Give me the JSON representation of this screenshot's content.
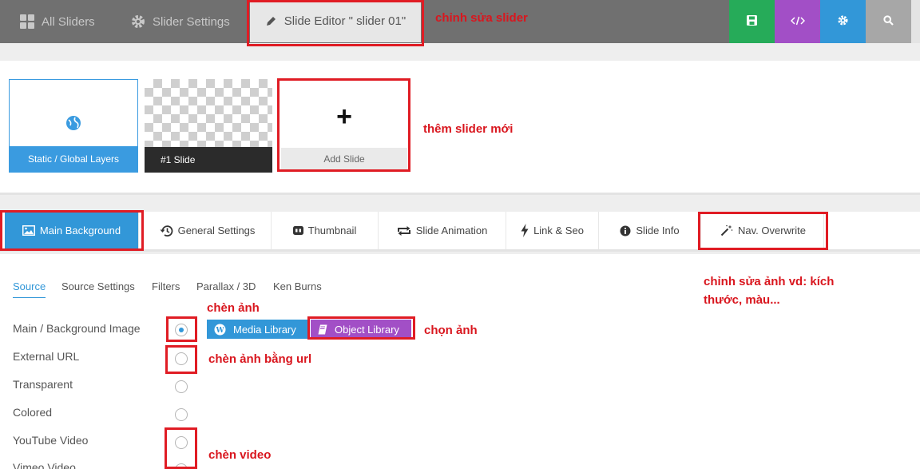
{
  "topbar": {
    "all_sliders": "All Sliders",
    "slider_settings": "Slider Settings",
    "slide_editor": "Slide Editor \" slider 01\"",
    "colors": {
      "save": "#26ab59",
      "code": "#a24fc6",
      "settings": "#3297d8",
      "search": "#a7a7a7"
    }
  },
  "slides": {
    "static_label": "Static / Global Layers",
    "slide1_label": "#1 Slide",
    "add_plus": "+",
    "add_label": "Add Slide"
  },
  "tabs": {
    "main_background": "Main Background",
    "general_settings": "General Settings",
    "thumbnail": "Thumbnail",
    "slide_animation": "Slide Animation",
    "link_seo": "Link & Seo",
    "slide_info": "Slide Info",
    "nav_overwrite": "Nav. Overwrite"
  },
  "subtabs": [
    "Source",
    "Source Settings",
    "Filters",
    "Parallax / 3D",
    "Ken Burns"
  ],
  "source_options": [
    "Main / Background Image",
    "External URL",
    "Transparent",
    "Colored",
    "YouTube Video",
    "Vimeo Video"
  ],
  "buttons": {
    "media_library": "Media Library",
    "object_library": "Object Library"
  },
  "annotations": {
    "edit_slider": "chỉnh sửa slider",
    "add_slider": "thêm slider mới",
    "edit_image_line1": "chỉnh sửa ảnh vd: kích",
    "edit_image_line2": "thước, màu...",
    "insert_image": "chèn ảnh",
    "choose_image": "chọn ảnh",
    "insert_image_url": "chèn ảnh bằng url",
    "insert_video": "chèn video"
  },
  "accent_color": "#3297d8",
  "annotation_color": "#e01c24"
}
